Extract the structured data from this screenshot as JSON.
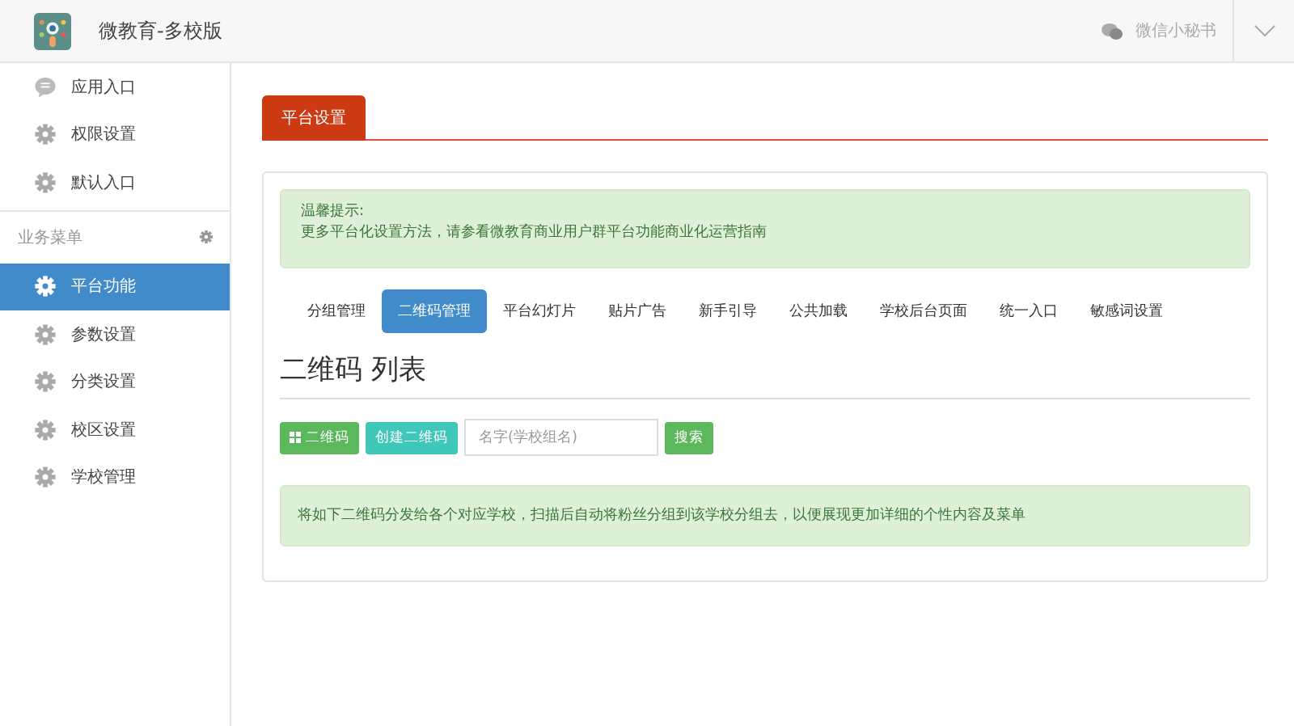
{
  "header": {
    "title": "微教育-多校版",
    "account": "微信小秘书"
  },
  "sidebar": {
    "top_items": [
      {
        "label": "应用入口",
        "selected": false
      },
      {
        "label": "权限设置",
        "selected": false
      },
      {
        "label": "默认入口",
        "selected": false
      }
    ],
    "section": {
      "title": "业务菜单"
    },
    "items": [
      {
        "label": "平台功能",
        "selected": true
      },
      {
        "label": "参数设置",
        "selected": false
      },
      {
        "label": "分类设置",
        "selected": false
      },
      {
        "label": "校区设置",
        "selected": false
      },
      {
        "label": "学校管理",
        "selected": false
      }
    ]
  },
  "page_tabs": [
    {
      "label": "平台设置",
      "selected": true
    }
  ],
  "notice": {
    "title": "温馨提示:",
    "text": "更多平台化设置方法，请参看微教育商业用户群平台功能商业化运营指南"
  },
  "nav": [
    {
      "label": "分组管理",
      "selected": false
    },
    {
      "label": "二维码管理",
      "selected": true
    },
    {
      "label": "平台幻灯片",
      "selected": false
    },
    {
      "label": "贴片广告",
      "selected": false
    },
    {
      "label": "新手引导",
      "selected": false
    },
    {
      "label": "公共加载",
      "selected": false
    },
    {
      "label": "学校后台页面",
      "selected": false
    },
    {
      "label": "统一入口",
      "selected": false
    },
    {
      "label": "敏感词设置",
      "selected": false
    }
  ],
  "heading": "二维码 列表",
  "toolbar": {
    "buttons": [
      {
        "label": "二维码",
        "kind": "qr"
      },
      {
        "label": "创建二维码",
        "kind": "create"
      }
    ],
    "search": {
      "placeholder": "名字(学校组名)"
    },
    "search_button": "搜索"
  },
  "info": "将如下二维码分发给各个对应学校，扫描后自动将粉丝分组到该学校分组去，以便展现更加详细的个性内容及菜单"
}
